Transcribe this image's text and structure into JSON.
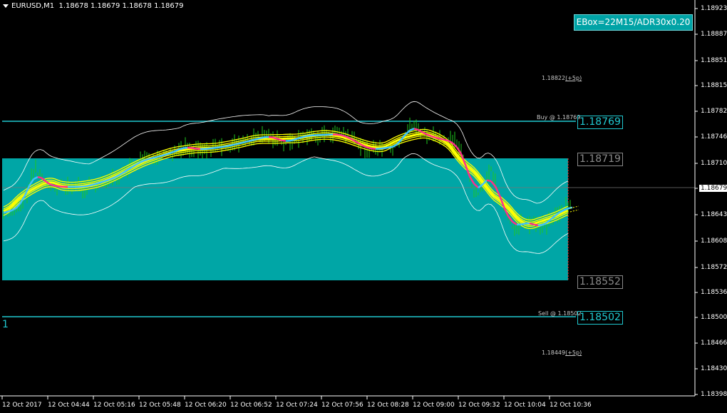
{
  "header": {
    "symbol": "EURUSD,M1",
    "ohlc": "1.18678 1.18679 1.18678 1.18679"
  },
  "badge": {
    "label": "EBox=22M15/ADR30x0.20"
  },
  "left_marker": "1",
  "levels": {
    "buy": {
      "label": "Buy @ 1.18769",
      "value": "1.18769",
      "color": "#20C8D0"
    },
    "box_top": {
      "value": "1.18719",
      "color": "#8a8a8a"
    },
    "box_bottom": {
      "value": "1.18552",
      "color": "#8a8a8a"
    },
    "sell": {
      "label": "Sell @ 1.18502",
      "value": "1.18502",
      "color": "#20C8D0"
    },
    "target_up": {
      "value": "1.18822",
      "suffix": "(+5p)"
    },
    "target_down": {
      "value": "1.18449",
      "suffix": "(+5p)"
    }
  },
  "y_axis": {
    "labels": [
      "1.18923",
      "1.18887",
      "1.18851",
      "1.18815",
      "1.18782",
      "1.18746",
      "1.18710",
      "1.18679",
      "1.18643",
      "1.18608",
      "1.18572",
      "1.18536",
      "1.18500",
      "1.18466",
      "1.18430",
      "1.18398"
    ],
    "current": "1.18679"
  },
  "x_axis": {
    "labels": [
      "12 Oct 2017",
      "12 Oct 04:44",
      "12 Oct 05:16",
      "12 Oct 05:48",
      "12 Oct 06:20",
      "12 Oct 06:52",
      "12 Oct 07:24",
      "12 Oct 07:56",
      "12 Oct 08:28",
      "12 Oct 09:00",
      "12 Oct 09:32",
      "12 Oct 10:04",
      "12 Oct 10:36"
    ]
  },
  "colors": {
    "box_fill": "#00A6A6",
    "level_line": "#20C8D0",
    "ma_line": "#FFFF00",
    "bands": "#FFFFFF",
    "candles": "#1EC81E",
    "trend_up": "#3EC1FF",
    "trend_down": "#FF2E8C"
  }
}
